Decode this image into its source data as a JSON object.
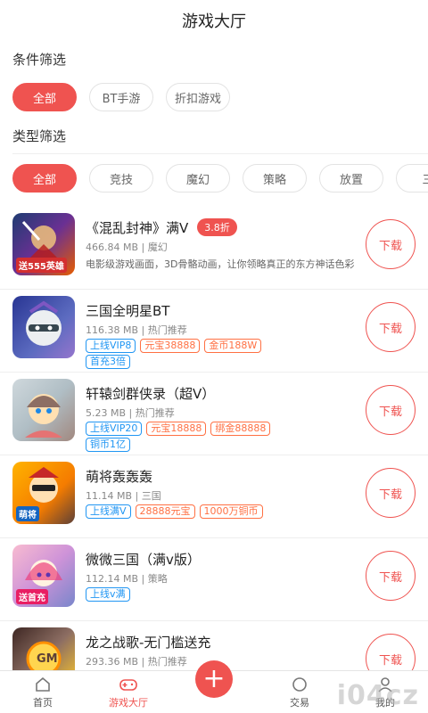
{
  "header": {
    "title": "游戏大厅"
  },
  "filters": {
    "condition_title": "条件筛选",
    "condition_chips": [
      "全部",
      "BT手游",
      "折扣游戏"
    ],
    "type_title": "类型筛选",
    "type_chips": [
      "全部",
      "竞技",
      "魔幻",
      "策略",
      "放置",
      "三"
    ]
  },
  "games": [
    {
      "name": "《混乱封神》满V",
      "discount": "3.8折",
      "size": "466.84 MB",
      "category": "魔幻",
      "desc": "电影级游戏画面，3D骨骼动画，让你领略真正的东方神话色彩",
      "icon_text": "送555英雄",
      "tags": [],
      "button": "下载"
    },
    {
      "name": "三国全明星BT",
      "discount": "",
      "size": "116.38 MB",
      "category": "热门推荐",
      "desc": "",
      "icon_text": "",
      "button": "下载",
      "tags": [
        {
          "text": "上线VIP8",
          "color": "blue"
        },
        {
          "text": "元宝38888",
          "color": "orange"
        },
        {
          "text": "金币188W",
          "color": "orange"
        },
        {
          "text": "首充3倍",
          "color": "blue"
        }
      ]
    },
    {
      "name": "轩辕剑群侠录（超V）",
      "discount": "",
      "size": "5.23 MB",
      "category": "热门推荐",
      "desc": "",
      "icon_text": "",
      "button": "下载",
      "tags": [
        {
          "text": "上线VIP20",
          "color": "blue"
        },
        {
          "text": "元宝18888",
          "color": "orange"
        },
        {
          "text": "绑金88888",
          "color": "orange"
        },
        {
          "text": "铜币1亿",
          "color": "blue"
        }
      ]
    },
    {
      "name": "萌将轰轰轰",
      "discount": "",
      "size": "11.14 MB",
      "category": "三国",
      "desc": "",
      "icon_text": "萌将",
      "button": "下载",
      "tags": [
        {
          "text": "上线满V",
          "color": "blue"
        },
        {
          "text": "28888元宝",
          "color": "orange"
        },
        {
          "text": "1000万铜币",
          "color": "orange"
        }
      ]
    },
    {
      "name": "微微三国（满v版）",
      "discount": "",
      "size": "112.14 MB",
      "category": "策略",
      "desc": "",
      "icon_text": "送首充",
      "button": "下载",
      "tags": [
        {
          "text": "上线v满",
          "color": "blue"
        }
      ]
    },
    {
      "name": "龙之战歌-无门槛送充",
      "discount": "",
      "size": "293.36 MB",
      "category": "热门推荐",
      "desc": "",
      "icon_text": "GM",
      "button": "下载",
      "tags": []
    }
  ],
  "tabbar": {
    "tabs": [
      {
        "label": "首页"
      },
      {
        "label": "游戏大厅"
      },
      {
        "label": ""
      },
      {
        "label": "交易"
      },
      {
        "label": "我的"
      }
    ],
    "plus": "+",
    "watermark": "i04cz"
  },
  "colors": {
    "accent": "#ef5350",
    "blue_tag": "#2196f3",
    "orange_tag": "#ff7043"
  }
}
